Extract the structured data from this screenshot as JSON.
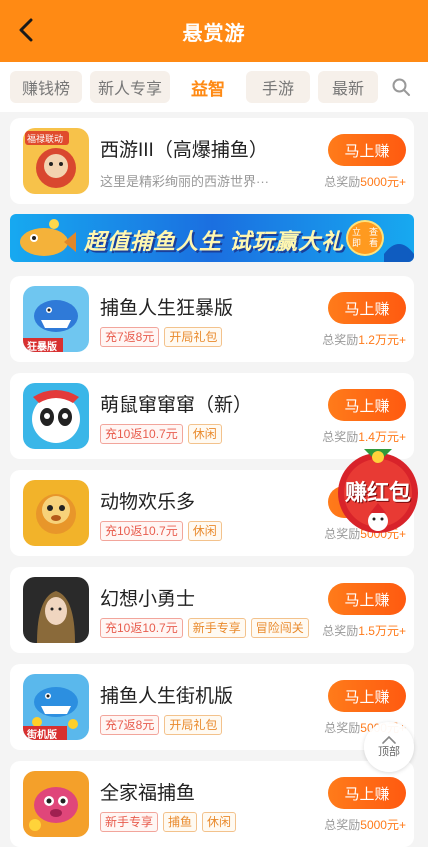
{
  "header": {
    "title": "悬赏游"
  },
  "tabs": [
    {
      "label": "赚钱榜",
      "active": false
    },
    {
      "label": "新人专享",
      "active": false
    },
    {
      "label": "益智",
      "active": true
    },
    {
      "label": "手游",
      "active": false
    },
    {
      "label": "最新",
      "active": false
    }
  ],
  "banner": {
    "text": "超值捕鱼人生 试玩赢大礼",
    "button_line1": "立即",
    "button_line2": "查看"
  },
  "floating": {
    "red_packet_label": "赚红包",
    "top_label": "顶部"
  },
  "games": [
    {
      "name": "西游III（高爆捕鱼）",
      "desc": "这里是精彩绚丽的西游世界···",
      "tags": [],
      "button": "马上赚",
      "reward_prefix": "总奖励",
      "reward_amount": "5000元+",
      "icon_badge": "福禄联动",
      "icon_color": "#c8432b"
    },
    {
      "name": "捕鱼人生狂暴版",
      "desc": "",
      "tags": [
        {
          "text": "充7返8元",
          "style": "red"
        },
        {
          "text": "开局礼包",
          "style": "orange"
        }
      ],
      "button": "马上赚",
      "reward_prefix": "总奖励",
      "reward_amount": "1.2万元+",
      "icon_badge": "狂暴版",
      "icon_color": "#2f7ad8"
    },
    {
      "name": "萌鼠窜窜窜（新）",
      "desc": "",
      "tags": [
        {
          "text": "充10返10.7元",
          "style": "red"
        },
        {
          "text": "休闲",
          "style": "orange"
        }
      ],
      "button": "马上赚",
      "reward_prefix": "总奖励",
      "reward_amount": "1.4万元+",
      "icon_badge": "",
      "icon_color": "#3ab6e8"
    },
    {
      "name": "动物欢乐多",
      "desc": "",
      "tags": [
        {
          "text": "充10返10.7元",
          "style": "red"
        },
        {
          "text": "休闲",
          "style": "orange"
        }
      ],
      "button": "马上赚",
      "reward_prefix": "总奖励",
      "reward_amount": "5000元+",
      "icon_badge": "",
      "icon_color": "#f2b32a"
    },
    {
      "name": "幻想小勇士",
      "desc": "",
      "tags": [
        {
          "text": "充10返10.7元",
          "style": "red"
        },
        {
          "text": "新手专享",
          "style": "orange"
        },
        {
          "text": "冒险闯关",
          "style": "orange"
        }
      ],
      "button": "马上赚",
      "reward_prefix": "总奖励",
      "reward_amount": "1.5万元+",
      "icon_badge": "",
      "icon_color": "#3a3a3a"
    },
    {
      "name": "捕鱼人生街机版",
      "desc": "",
      "tags": [
        {
          "text": "充7返8元",
          "style": "red"
        },
        {
          "text": "开局礼包",
          "style": "orange"
        }
      ],
      "button": "马上赚",
      "reward_prefix": "总奖励",
      "reward_amount": "5000元+",
      "icon_badge": "街机版",
      "icon_color": "#2c8fe0"
    },
    {
      "name": "全家福捕鱼",
      "desc": "",
      "tags": [
        {
          "text": "新手专享",
          "style": "red"
        },
        {
          "text": "捕鱼",
          "style": "orange"
        },
        {
          "text": "休闲",
          "style": "orange"
        }
      ],
      "button": "马上赚",
      "reward_prefix": "总奖励",
      "reward_amount": "5000元+",
      "icon_badge": "",
      "icon_color": "#e0467a"
    }
  ],
  "colors": {
    "accent": "#ff8a14",
    "button": "#ff6a14",
    "reward": "#ff7a1a"
  }
}
